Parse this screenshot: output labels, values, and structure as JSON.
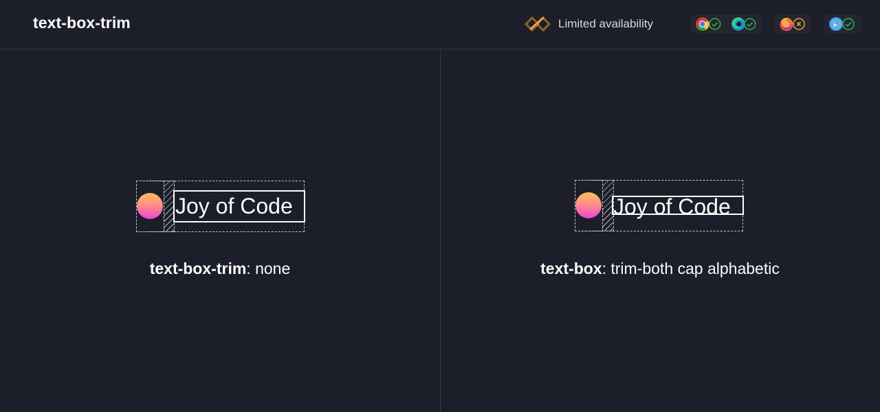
{
  "header": {
    "title": "text-box-trim",
    "availability_label": "Limited availability",
    "availability_icon": "limited-availability-icon",
    "browsers": [
      {
        "name": "chrome-icon",
        "status": "supported"
      },
      {
        "name": "edge-icon",
        "status": "supported"
      },
      {
        "name": "firefox-icon",
        "status": "unsupported"
      },
      {
        "name": "safari-icon",
        "status": "supported"
      }
    ]
  },
  "colors": {
    "background": "#1c1e2a",
    "divider": "#353846",
    "supported": "#2fb35a",
    "unsupported": "#f0a030",
    "dot_top": "#ffbe5c",
    "dot_bottom": "#ee44d8"
  },
  "demos": [
    {
      "text": "Joy of Code",
      "caption_property": "text-box-trim",
      "caption_value": ": none"
    },
    {
      "text": "Joy of Code",
      "caption_property": "text-box",
      "caption_value": ": trim-both cap alphabetic"
    }
  ]
}
